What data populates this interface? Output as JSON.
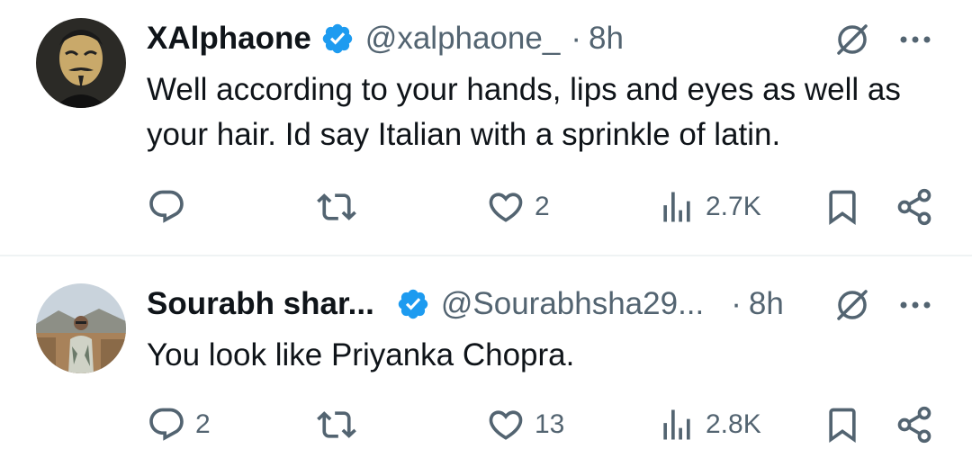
{
  "tweets": [
    {
      "display_name": "XAlphaone",
      "handle": "@xalphaone_",
      "separator": "·",
      "time": "8h",
      "text": "Well according to your hands, lips and eyes as well as your hair. Id say Italian with a sprinkle of latin.",
      "replies": "",
      "retweets": "",
      "likes": "2",
      "views": "2.7K",
      "avatar_icon": "guy-fawkes-mask-avatar"
    },
    {
      "display_name": "Sourabh shar...",
      "handle": "@Sourabhsha29...",
      "separator": "·",
      "time": "8h",
      "text": "You look like Priyanka Chopra.",
      "replies": "2",
      "retweets": "",
      "likes": "13",
      "views": "2.8K",
      "avatar_icon": "person-outdoor-photo-avatar"
    }
  ],
  "colors": {
    "verified_blue": "#1d9bf0",
    "text_primary": "#0f1419",
    "text_secondary": "#536471",
    "divider": "#eff3f4"
  },
  "icons": [
    "verified-badge-icon",
    "grok-icon",
    "more-icon",
    "reply-icon",
    "retweet-icon",
    "like-icon",
    "views-icon",
    "bookmark-icon",
    "share-icon"
  ]
}
